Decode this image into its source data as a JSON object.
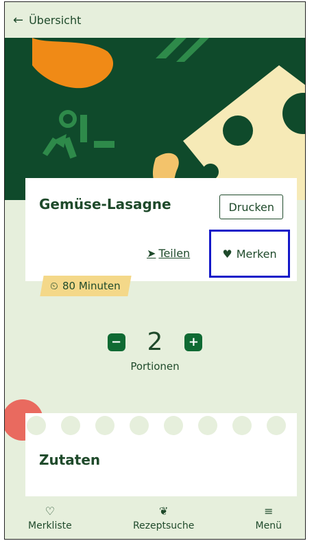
{
  "header": {
    "back_label": "Übersicht",
    "back_icon": "back-arrow-icon"
  },
  "recipe": {
    "title": "Gemüse-Lasagne",
    "print_label": "Drucken",
    "share_label": "Teilen",
    "save_label": "Merken",
    "time_label": "80 Minuten"
  },
  "portions": {
    "count": "2",
    "label": "Portionen"
  },
  "ingredients": {
    "title": "Zutaten"
  },
  "bottom_nav": [
    {
      "label": "Merkliste",
      "icon": "heart-outline-icon"
    },
    {
      "label": "Rezeptsuche",
      "icon": "vegetable-icon"
    },
    {
      "label": "Menü",
      "icon": "menu-icon"
    }
  ],
  "colors": {
    "primary": "#0f4a2b",
    "background": "#e6efdc",
    "accent_yellow": "#f4d889",
    "highlight": "#1418c8"
  }
}
